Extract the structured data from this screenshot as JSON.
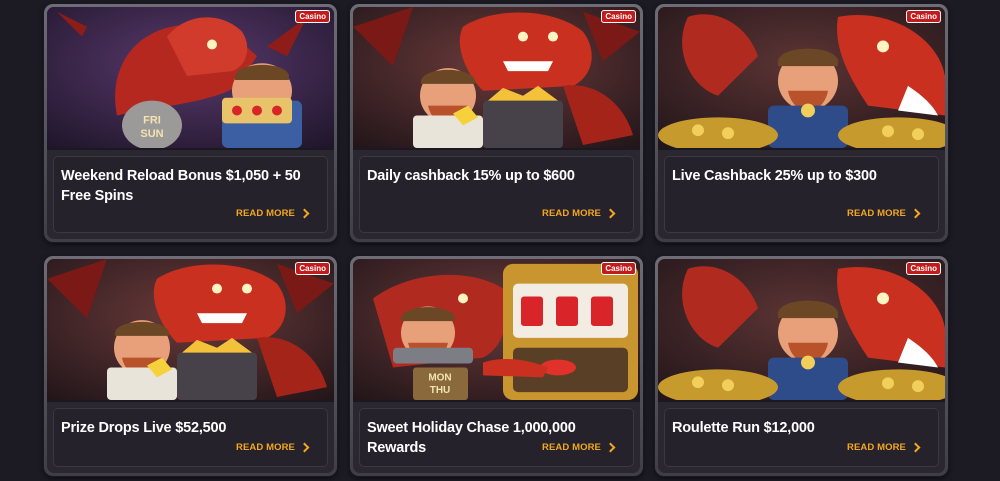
{
  "badge_label": "Casino",
  "read_more_label": "READ MORE",
  "colors": {
    "background": "#1c1a22",
    "accent": "#f3a71f",
    "badge": "#c21b1b"
  },
  "promotions": [
    {
      "title": "Weekend Reload Bonus $1,050 + 50 Free Spins",
      "art": "dragon-miner-fri-sun-slot-icon",
      "art_text": "FRI SUN"
    },
    {
      "title": "Daily cashback 15% up to $600",
      "art": "dragon-miner-gold-cart-icon",
      "art_text": ""
    },
    {
      "title": "Live Cashback 25% up to $300",
      "art": "dragon-miner-gold-coins-icon",
      "art_text": ""
    },
    {
      "title": "Prize Drops Live $52,500",
      "art": "dragon-miner-gold-cart-icon",
      "art_text": ""
    },
    {
      "title": "Sweet Holiday Chase 1,000,000 Rewards",
      "art": "dragon-miner-mon-thu-slot-icon",
      "art_text": "MON THU"
    },
    {
      "title": "Roulette Run $12,000",
      "art": "dragon-miner-gold-coins-icon",
      "art_text": ""
    }
  ]
}
